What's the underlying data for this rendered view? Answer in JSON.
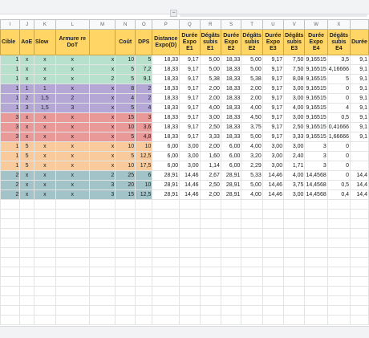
{
  "columns": [
    "I",
    "J",
    "K",
    "L",
    "M",
    "N",
    "O",
    "P",
    "Q",
    "R",
    "S",
    "T",
    "U",
    "V",
    "W",
    "X",
    ""
  ],
  "headers": [
    "Cible",
    "AoE",
    "Slow",
    "Armure re DoT",
    "",
    "Coût",
    "DPS",
    "Distance Expo(D)",
    "Durée Expo E1",
    "Dégâts subis E1",
    "Durée Expo E2",
    "Dégâts subis E2",
    "Durée Expo E3",
    "Dégâts subis E3",
    "Durée Expo E4",
    "Dégâts subis E4",
    "Durée"
  ],
  "groups": [
    {
      "color": "green",
      "rows": [
        [
          "1",
          "x",
          "x",
          "x",
          "x",
          "10",
          "5",
          "18,33",
          "9,17",
          "5,00",
          "18,33",
          "5,00",
          "9,17",
          "7,50",
          "9,16515",
          "3,5",
          "9,1"
        ],
        [
          "1",
          "x",
          "x",
          "x",
          "x",
          "5",
          "7,2",
          "18,33",
          "9,17",
          "5,00",
          "18,33",
          "5,00",
          "9,17",
          "7,50",
          "9,16515",
          "4,16666",
          "9,1"
        ],
        [
          "1",
          "x",
          "x",
          "x",
          "2",
          "5",
          "9,1",
          "18,33",
          "9,17",
          "5,38",
          "18,33",
          "5,38",
          "9,17",
          "8,08",
          "9,16515",
          "5",
          "9,1"
        ]
      ]
    },
    {
      "color": "purple",
      "rows": [
        [
          "1",
          "1",
          "1",
          "x",
          "x",
          "8",
          "2",
          "18,33",
          "9,17",
          "2,00",
          "18,33",
          "2,00",
          "9,17",
          "3,00",
          "9,16515",
          "0",
          "9,1"
        ],
        [
          "1",
          "2",
          "1,5",
          "2",
          "x",
          "4",
          "2",
          "18,33",
          "9,17",
          "2,00",
          "18,33",
          "2,00",
          "9,17",
          "3,00",
          "9,16515",
          "0",
          "9,1"
        ],
        [
          "1",
          "3",
          "1,5",
          "3",
          "x",
          "5",
          "4",
          "18,33",
          "9,17",
          "4,00",
          "18,33",
          "4,00",
          "9,17",
          "4,00",
          "9,16515",
          "4",
          "9,1"
        ]
      ]
    },
    {
      "color": "red",
      "rows": [
        [
          "3",
          "x",
          "x",
          "x",
          "x",
          "15",
          "3",
          "18,33",
          "9,17",
          "3,00",
          "18,33",
          "4,50",
          "9,17",
          "3,00",
          "9,16515",
          "0,5",
          "9,1"
        ],
        [
          "3",
          "x",
          "x",
          "x",
          "x",
          "10",
          "3,6",
          "18,33",
          "9,17",
          "2,50",
          "18,33",
          "3,75",
          "9,17",
          "2,50",
          "9,16515",
          "0,41666",
          "9,1"
        ],
        [
          "3",
          "x",
          "x",
          "x",
          "x",
          "5",
          "4,8",
          "18,33",
          "9,17",
          "3,33",
          "18,33",
          "5,00",
          "9,17",
          "3,33",
          "9,16515",
          "1,66666",
          "9,1"
        ]
      ]
    },
    {
      "color": "orange",
      "rows": [
        [
          "1",
          "5",
          "x",
          "x",
          "x",
          "10",
          "10",
          "6,00",
          "3,00",
          "2,00",
          "6,00",
          "4,00",
          "3,00",
          "3,00",
          "3",
          "0",
          ""
        ],
        [
          "1",
          "5",
          "x",
          "x",
          "x",
          "5",
          "12,5",
          "6,00",
          "3,00",
          "1,60",
          "6,00",
          "3,20",
          "3,00",
          "2,40",
          "3",
          "0",
          ""
        ],
        [
          "1",
          "5",
          "x",
          "x",
          "x",
          "10",
          "17,5",
          "6,00",
          "3,00",
          "1,14",
          "6,00",
          "2,29",
          "3,00",
          "1,71",
          "3",
          "0",
          ""
        ]
      ]
    },
    {
      "color": "teal",
      "rows": [
        [
          "2",
          "x",
          "x",
          "x",
          "2",
          "25",
          "6",
          "28,91",
          "14,46",
          "2,67",
          "28,91",
          "5,33",
          "14,46",
          "4,00",
          "14,4568",
          "0",
          "14,4"
        ],
        [
          "2",
          "x",
          "x",
          "x",
          "3",
          "20",
          "10",
          "28,91",
          "14,46",
          "2,50",
          "28,91",
          "5,00",
          "14,46",
          "3,75",
          "14,4568",
          "0,5",
          "14,4"
        ],
        [
          "2",
          "x",
          "x",
          "x",
          "3",
          "15",
          "12,5",
          "28,91",
          "14,46",
          "2,00",
          "28,91",
          "4,00",
          "14,46",
          "3,00",
          "14,4568",
          "0,4",
          "14,4"
        ]
      ]
    }
  ]
}
